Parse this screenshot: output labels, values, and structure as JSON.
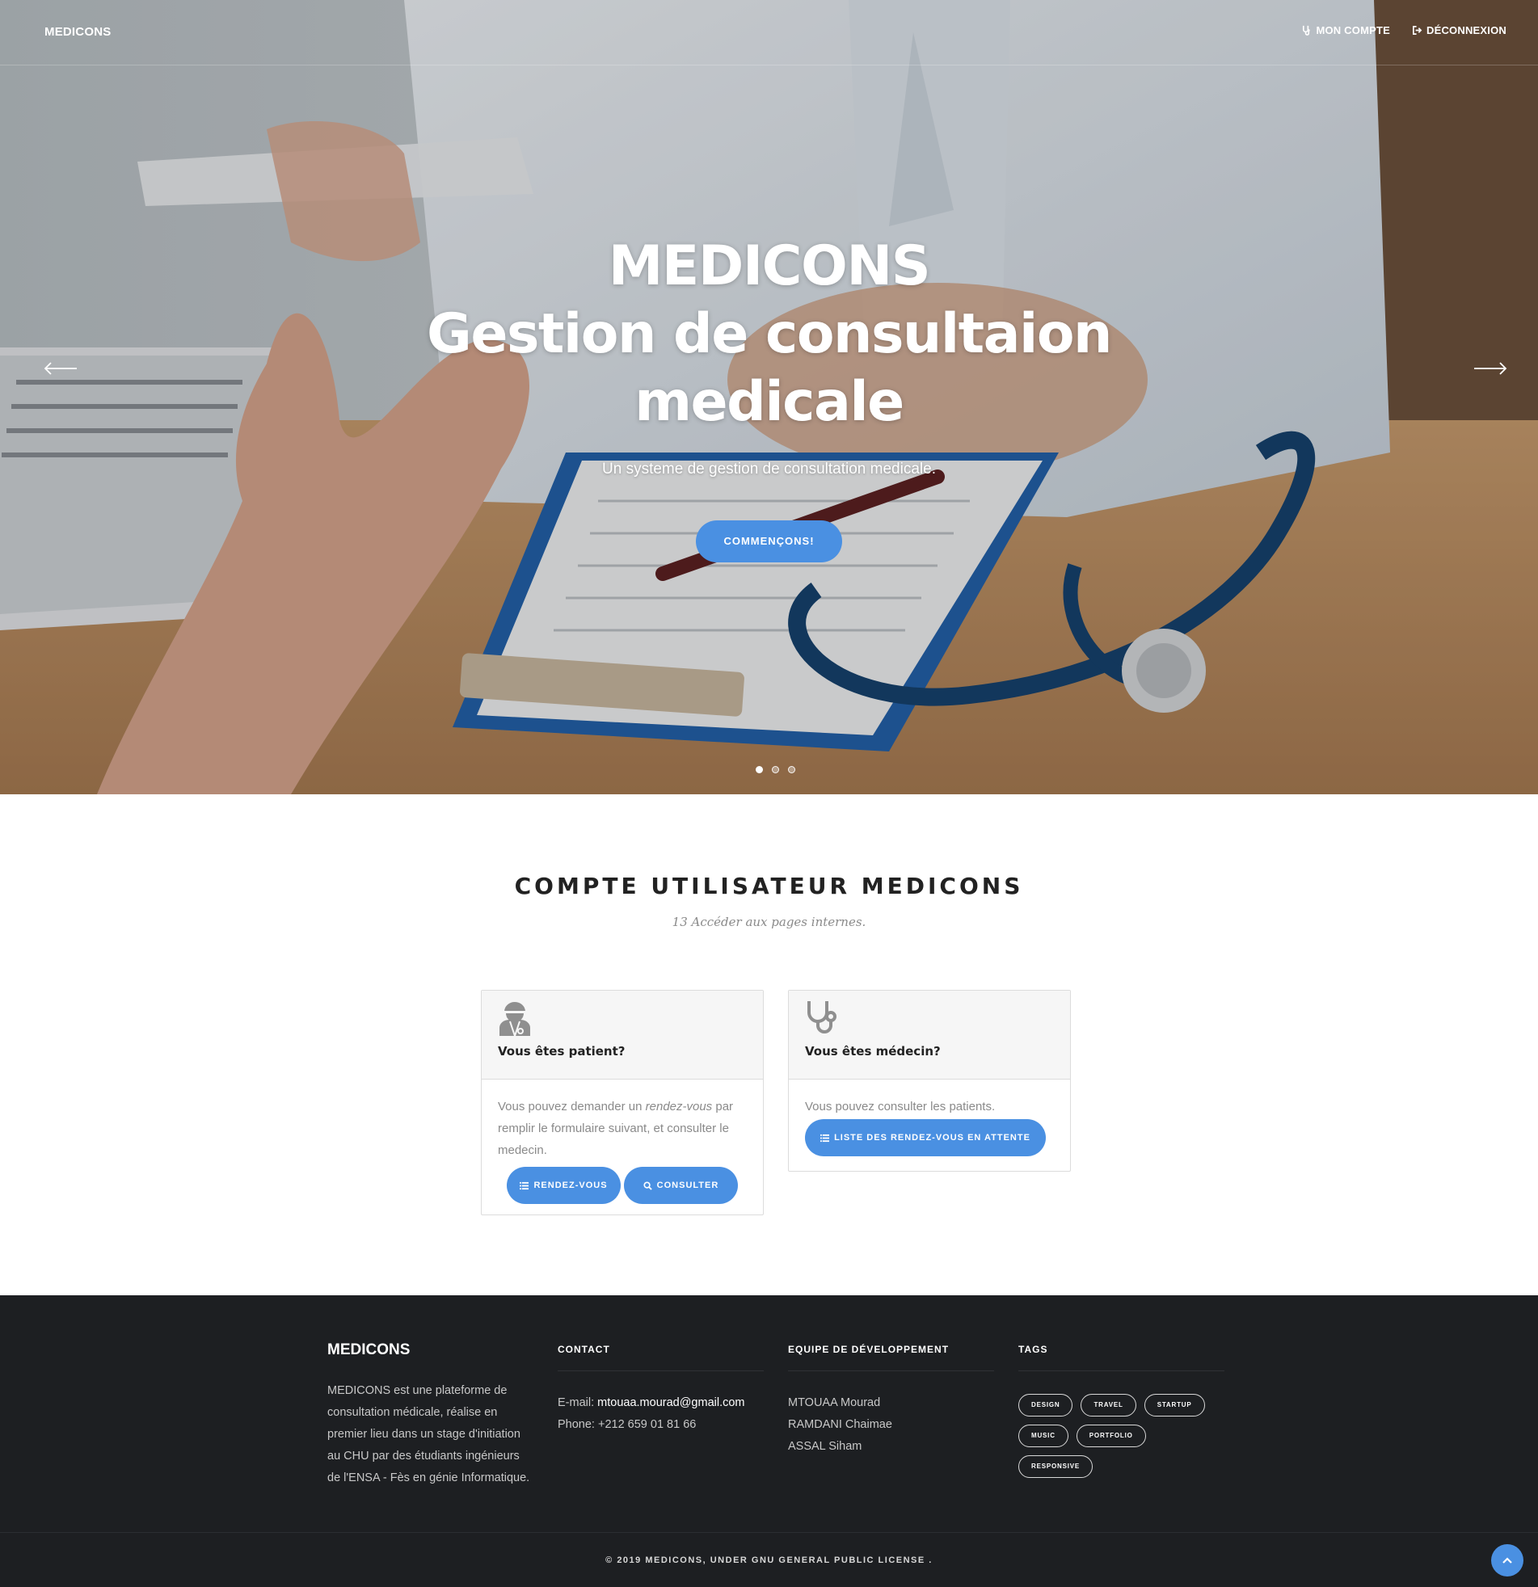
{
  "navbar": {
    "brand": "MEDICONS",
    "account_label": "MON COMPTE",
    "logout_label": "DÉCONNEXION"
  },
  "hero": {
    "title_line1": "MEDICONS",
    "title_line2": "Gestion de consultaion",
    "title_line3": "medicale",
    "subtitle": "Un systeme de gestion de consultation medicale.",
    "cta_label": "COMMENÇONS!",
    "slides_count": 3,
    "active_slide": 1
  },
  "section": {
    "title": "COMPTE UTILISATEUR MEDICONS",
    "subtitle": "13 Accéder aux pages internes."
  },
  "patient_card": {
    "heading": "Vous êtes patient?",
    "text_before": "Vous pouvez demander un ",
    "text_emph": "rendez-vous",
    "text_after": " par remplir le formulaire suivant, et consulter le medecin.",
    "btn_rdv": "RENDEZ-VOUS",
    "btn_consult": "CONSULTER",
    "icon": "patient-icon"
  },
  "doctor_card": {
    "heading": "Vous êtes médecin?",
    "text": "Vous pouvez consulter les patients.",
    "btn_list": "LISTE DES RENDEZ-VOUS EN ATTENTE",
    "icon": "stethoscope-icon"
  },
  "footer": {
    "brand": "MEDICONS",
    "about": "MEDICONS est une plateforme de consultation médicale, réalise en premier lieu dans un stage d'initiation au CHU par des étudiants ingénieurs de l'ENSA - Fès en génie Informatique.",
    "contact_head": "CONTACT",
    "email_label": "E-mail: ",
    "email": "mtouaa.mourad@gmail.com",
    "phone": "Phone: +212 659 01 81 66",
    "team_head": "EQUIPE DE DÉVELOPPEMENT",
    "team": [
      "MTOUAA Mourad",
      "RAMDANI Chaimae",
      "ASSAL Siham"
    ],
    "tags_head": "TAGS",
    "tags": [
      "DESIGN",
      "TRAVEL",
      "STARTUP",
      "MUSIC",
      "PORTFOLIO",
      "RESPONSIVE"
    ],
    "copyright": "© 2019 MEDICONS, UNDER GNU GENERAL PUBLIC LICENSE ."
  },
  "colors": {
    "accent": "#4a90e2",
    "footer_bg": "#1d1f22",
    "heading": "#222222",
    "muted": "#8a8a8a"
  }
}
